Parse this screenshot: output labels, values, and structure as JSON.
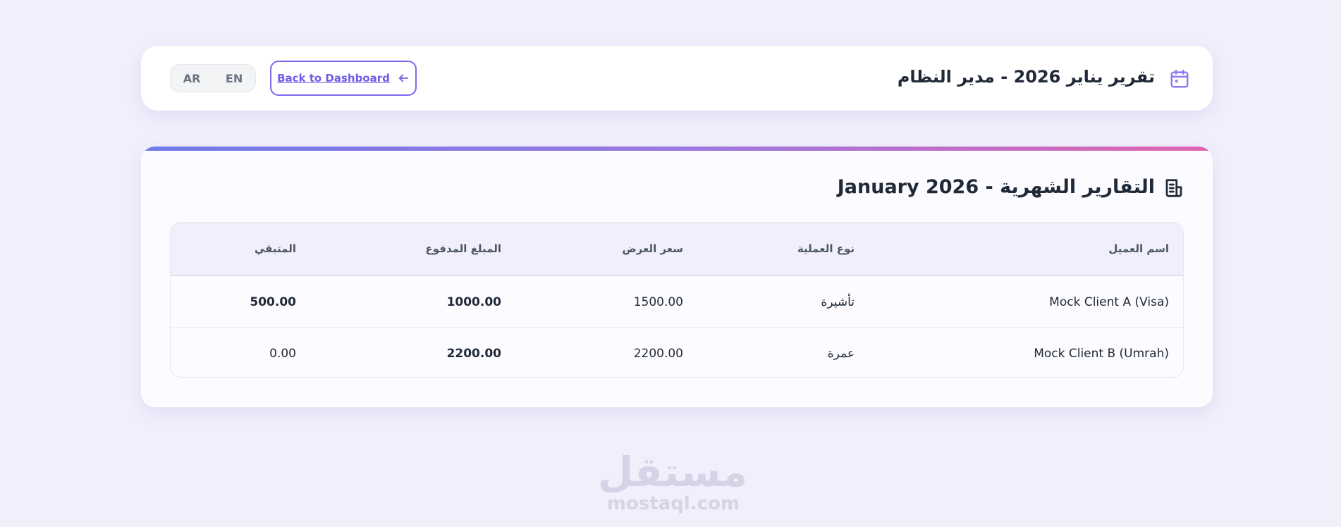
{
  "header": {
    "title": "تقرير يناير 2026 - مدير النظام",
    "icon": "calendar-icon",
    "back_label": "Back to Dashboard",
    "lang_ar": "AR",
    "lang_en": "EN"
  },
  "report": {
    "title": "التقارير الشهرية - January 2026",
    "icon": "document-icon",
    "columns": [
      "اسم العميل",
      "نوع العملية",
      "سعر العرض",
      "المبلغ المدفوع",
      "المتبقي"
    ],
    "rows": [
      {
        "client": "Mock Client A (Visa)",
        "type": "تأشيرة",
        "price": "1500.00",
        "paid": "1000.00",
        "remaining": "500.00"
      },
      {
        "client": "Mock Client B (Umrah)",
        "type": "عمرة",
        "price": "2200.00",
        "paid": "2200.00",
        "remaining": "0.00"
      }
    ]
  },
  "watermark": {
    "arabic": "مستقل",
    "english": "mostaql.com"
  },
  "colors": {
    "accent": "#7b68ee",
    "paid": "#16a96b",
    "remaining_due": "#dc3545",
    "background": "#f1effc"
  }
}
